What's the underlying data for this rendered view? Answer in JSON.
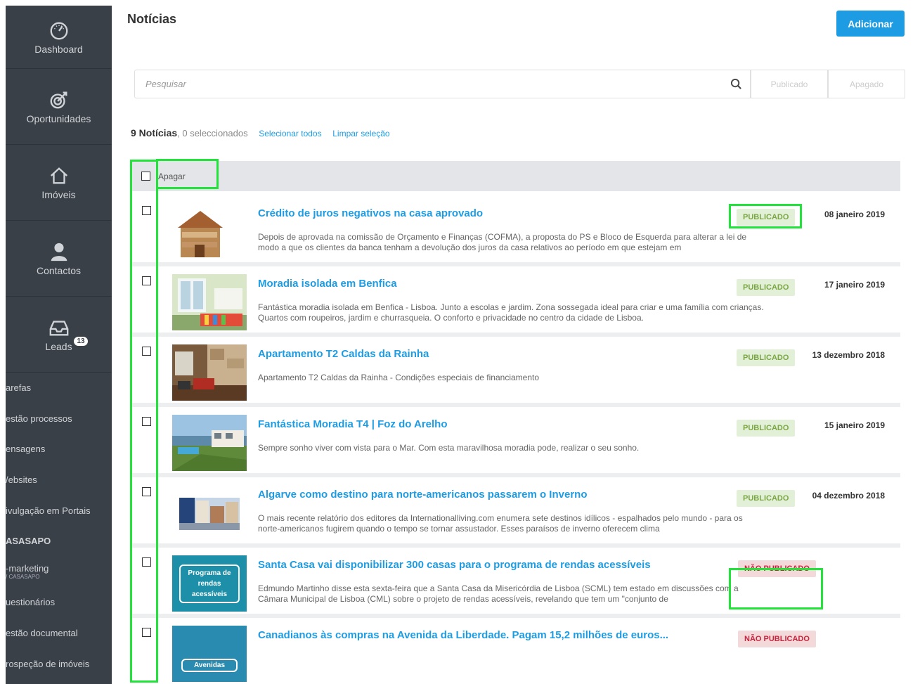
{
  "sidebar": {
    "nav": [
      {
        "label": "Dashboard",
        "icon": "dashboard-icon"
      },
      {
        "label": "Oportunidades",
        "icon": "target-icon"
      },
      {
        "label": "Imóveis",
        "icon": "home-icon"
      },
      {
        "label": "Contactos",
        "icon": "user-icon"
      },
      {
        "label": "Leads",
        "icon": "inbox-icon",
        "badge": "13"
      }
    ],
    "links": [
      "arefas",
      "estão processos",
      "ensagens",
      "/ebsites",
      "ivulgação em Portais",
      "ASASAPO",
      "-marketing",
      "uestionários",
      "estão documental",
      "rospeção de imóveis"
    ],
    "marketing_sub": "/ CASASAPO"
  },
  "header": {
    "title": "Notícias",
    "add_label": "Adicionar"
  },
  "search": {
    "placeholder": "Pesquisar",
    "filters": [
      "Publicado",
      "Apagado"
    ]
  },
  "summary": {
    "count": "9 Notícias",
    "selected": ", 0 seleccionados",
    "select_all": "Selecionar todos",
    "clear": "Limpar seleção"
  },
  "bulk": {
    "delete_label": "Apagar"
  },
  "items": [
    {
      "title": "Crédito de juros negativos na casa aprovado",
      "desc": "Depois de aprovada na comissão de Orçamento e Finanças (COFMA), a proposta do PS e Bloco de Esquerda para alterar a lei de modo a que os clientes da banca tenham a devolução dos juros da casa relativos ao período em que estejam em",
      "status": "PUBLICADO",
      "date": "08 janeiro 2019"
    },
    {
      "title": "Moradia isolada em Benfica",
      "desc": "Fantástica moradia isolada em Benfica - Lisboa. Junto a escolas e jardim. Zona sossegada ideal para criar e uma família com crianças. Quartos com roupeiros, jardim e churrasqueia. O conforto e privacidade no centro da cidade de Lisboa.",
      "status": "PUBLICADO",
      "date": "17 janeiro 2019"
    },
    {
      "title": "Apartamento T2 Caldas da Rainha",
      "desc": "Apartamento T2 Caldas da Rainha - Condições especiais de financiamento",
      "status": "PUBLICADO",
      "date": "13 dezembro 2018"
    },
    {
      "title": "Fantástica Moradia T4 | Foz do Arelho",
      "desc": "Sempre sonho viver com vista para o Mar. Com esta maravilhosa moradia pode, realizar o seu sonho.",
      "status": "PUBLICADO",
      "date": "15 janeiro 2019"
    },
    {
      "title": "Algarve como destino para norte-americanos passarem o Inverno",
      "desc": "O mais recente relatório dos editores da Internationalliving.com enumera sete destinos idílicos - espalhados pelo mundo - para os norte-americanos fugirem quando o tempo se tornar assustador. Esses paraísos de inverno oferecem clima",
      "status": "PUBLICADO",
      "date": "04 dezembro 2018"
    },
    {
      "title": "Santa Casa vai disponibilizar 300 casas para o programa de rendas acessíveis",
      "desc": "Edmundo Martinho disse esta sexta-feira que a Santa Casa da Misericórdia de Lisboa (SCML) tem estado em discussões com a Câmara Municipal de Lisboa (CML) sobre o projeto de rendas acessíveis, revelando que tem um \"conjunto de",
      "status": "NÃO PUBLICADO",
      "date": "",
      "thumb_text": "Programa de rendas acessíveis"
    },
    {
      "title": "Canadianos às compras na Avenida da Liberdade. Pagam 15,2 milhões de euros...",
      "desc": "",
      "status": "NÃO PUBLICADO",
      "date": "",
      "thumb_text": "Avenidas"
    }
  ]
}
